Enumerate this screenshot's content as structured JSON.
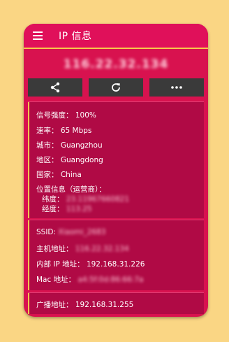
{
  "appbar": {
    "title": "IP 信息"
  },
  "ip_address": "116.22.32.134",
  "actions": [
    {
      "icon": "share-icon"
    },
    {
      "icon": "refresh-icon"
    },
    {
      "icon": "more-icon"
    }
  ],
  "info": {
    "signal": "信号强度： 100%",
    "rate": "速率： 65 Mbps",
    "city": "城市： Guangzhou",
    "region": "地区： Guangdong",
    "country": "国家： China",
    "location_label": "位置信息（运营商）：",
    "lat_label": "纬度：",
    "lat_value": "23.11967660821",
    "lng_label": "经度：",
    "lng_value": "113.25"
  },
  "network": {
    "ssid_label": "SSID:",
    "ssid_value": "Xiaomi_2683",
    "host_label": "主机地址：",
    "host_value": "116.22.32.134",
    "internal_ip": "内部 IP 地址： 192.168.31.226",
    "mac_label": "Mac 地址：",
    "mac_value": "a4:5f:0d:86:66:7a"
  },
  "broadcast": "广播地址： 192.168.31.255",
  "colors": {
    "background": "#FAD684",
    "primary": "#D8124F",
    "card": "#B00A45",
    "accent": "#F7C84A",
    "button": "#3A3A3A"
  }
}
